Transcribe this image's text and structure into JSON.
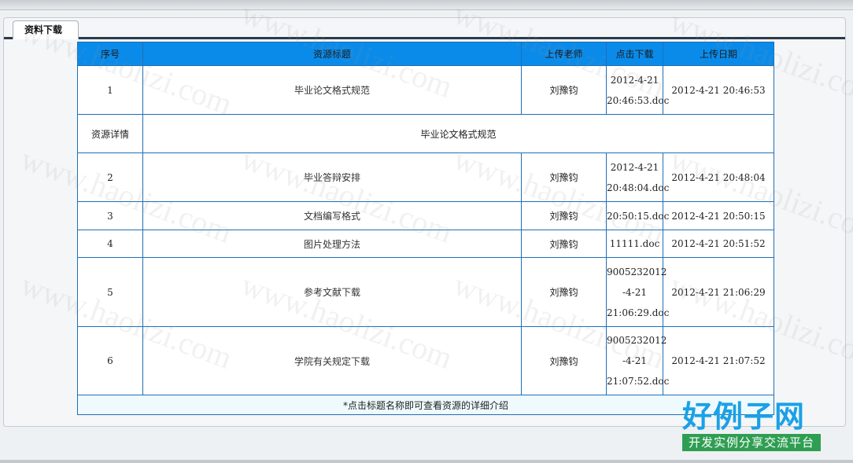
{
  "tab": {
    "label": "资料下载"
  },
  "table": {
    "headers": [
      "序号",
      "资源标题",
      "上传老师",
      "点击下载",
      "上传日期"
    ],
    "rows": [
      {
        "index": "1",
        "title": "毕业论文格式规范",
        "teacher": "刘豫钧",
        "download": [
          "2012-4-21",
          "20:46:53.doc"
        ],
        "date": "2012-4-21 20:46:53"
      },
      {
        "index": "2",
        "title": "毕业答辩安排",
        "teacher": "刘豫钧",
        "download": [
          "2012-4-21",
          "20:48:04.doc"
        ],
        "date": "2012-4-21 20:48:04"
      },
      {
        "index": "3",
        "title": "文档编写格式",
        "teacher": "刘豫钧",
        "download": [
          "20:50:15.doc"
        ],
        "date": "2012-4-21 20:50:15"
      },
      {
        "index": "4",
        "title": "图片处理方法",
        "teacher": "刘豫钧",
        "download": [
          "11111.doc"
        ],
        "date": "2012-4-21 20:51:52"
      },
      {
        "index": "5",
        "title": "参考文献下载",
        "teacher": "刘豫钧",
        "download": [
          "9005232012",
          "-4-21",
          "21:06:29.doc"
        ],
        "date": "2012-4-21 21:06:29"
      },
      {
        "index": "6",
        "title": "学院有关规定下载",
        "teacher": "刘豫钧",
        "download": [
          "9005232012",
          "-4-21",
          "21:07:52.doc"
        ],
        "date": "2012-4-21 21:07:52"
      }
    ],
    "detail": {
      "label": "资源详情",
      "value": "毕业论文格式规范"
    },
    "footer_note": "*点击标题名称即可查看资源的详细介绍"
  },
  "watermark": "www.haolizi.com",
  "logo": {
    "main": "好例子网",
    "sub": "开发实例分享交流平台"
  },
  "colors": {
    "header_bg": "#0a8bea",
    "border": "#1f6fb5",
    "footer_bg": "#eefafd",
    "logo_blue": "#1aa1e6",
    "logo_green": "#2f9e52"
  }
}
